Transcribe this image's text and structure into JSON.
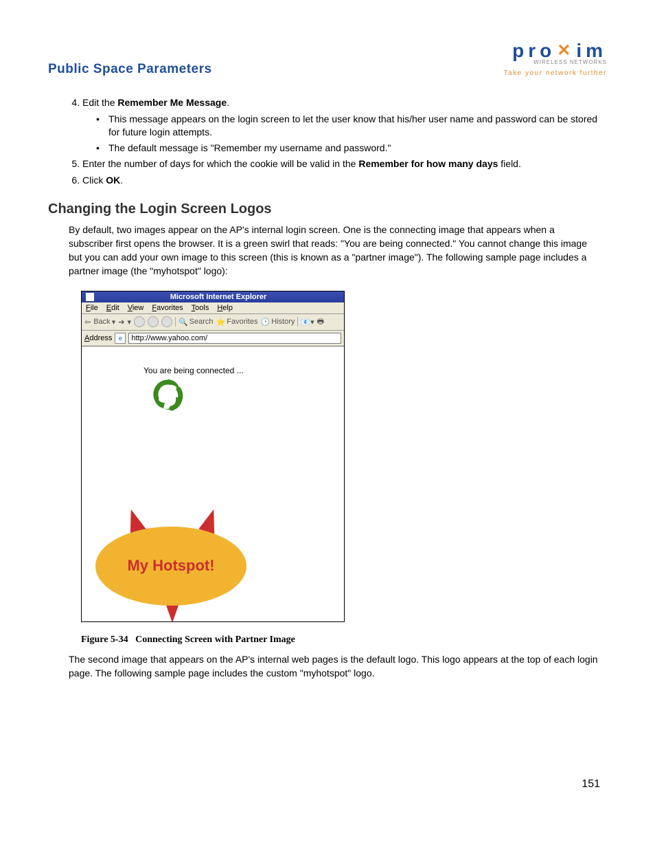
{
  "header": {
    "section_title": "Public Space Parameters",
    "logo": {
      "pre": "pro",
      "post": "im",
      "sub": "WIRELESS NETWORKS",
      "tagline": "Take your network further"
    }
  },
  "list": {
    "item4": {
      "lead": "Edit the ",
      "bold": "Remember Me Message",
      "tail": ".",
      "bullets": [
        "This message appears on the login screen to let the user know that his/her user name and password can be stored for future login attempts.",
        "The default message is \"Remember my username and password.\""
      ]
    },
    "item5": {
      "lead": "Enter the number of days for which the cookie will be valid in the ",
      "bold": "Remember for how many days",
      "tail": " field."
    },
    "item6": {
      "lead": "Click ",
      "bold": "OK",
      "tail": "."
    }
  },
  "subsection": {
    "title": "Changing the Login Screen Logos",
    "para1": "By default, two images appear on the AP's internal login screen. One is the connecting image that appears when a subscriber first opens the browser. It is a green swirl that reads: \"You are being connected.\" You cannot change this image but you can add your own image to this screen (this is known as a \"partner image\"). The following sample page includes a partner image (the \"myhotspot\" logo):"
  },
  "ie": {
    "title": "Microsoft Internet Explorer",
    "menus": [
      "File",
      "Edit",
      "View",
      "Favorites",
      "Tools",
      "Help"
    ],
    "toolbar": {
      "back": "Back",
      "search": "Search",
      "favorites": "Favorites",
      "history": "History"
    },
    "address_label": "Address",
    "address_value": "http://www.yahoo.com/",
    "connected": "You are being connected ...",
    "badge": "My Hotspot!"
  },
  "figure": {
    "num": "Figure 5-34",
    "caption": "Connecting Screen with Partner Image"
  },
  "para2": "The second image that appears on the AP's internal web pages is the default logo. This logo appears at the top of each login page. The following sample page includes the custom \"myhotspot\" logo.",
  "page_number": "151"
}
